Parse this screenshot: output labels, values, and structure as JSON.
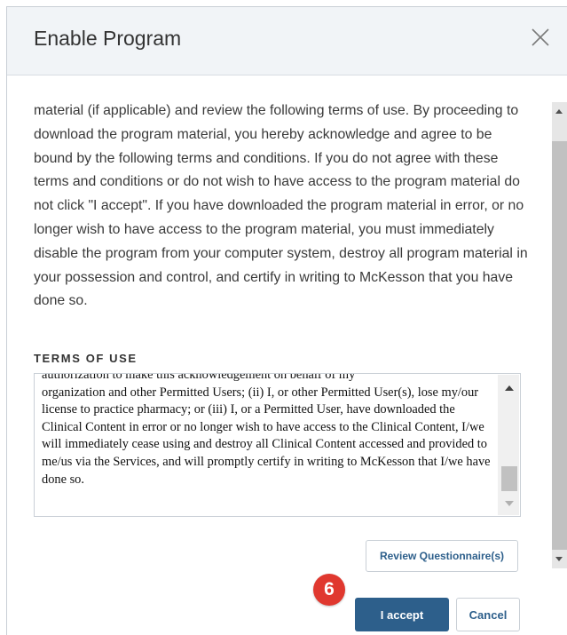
{
  "dialog": {
    "title": "Enable Program",
    "close_icon": "close-icon"
  },
  "intro_text": "material (if applicable) and review the following terms of use. By proceeding to download the program material, you hereby acknowledge and agree to be bound by the following terms and conditions. If you do not agree with these terms and conditions or do not wish to have access to the program material do not click \"I accept\". If you have downloaded the program material in error, or no longer wish to have access to the program material, you must immediately disable the program from your computer system, destroy all program material in your possession and control, and certify in writing to McKesson that you have done so.",
  "terms": {
    "heading": "TERMS OF USE",
    "partial_first_line": "authorization to make this acknowledgement on behalf of my",
    "text": "organization and other Permitted Users; (ii) I, or other Permitted User(s), lose my/our license to practice pharmacy; or (iii) I, or a Permitted User, have downloaded the Clinical Content in error or no longer wish to have access to the Clinical Content, I/we will immediately cease using and destroy all Clinical Content accessed and provided to me/us via the Services, and will promptly certify in writing to McKesson that I/we have done so."
  },
  "buttons": {
    "review": "Review Questionnaire(s)",
    "accept": "I accept",
    "cancel": "Cancel"
  },
  "annotation": {
    "step_number": "6"
  },
  "colors": {
    "primary": "#2d5f8b",
    "badge": "#e0382f",
    "header_bg": "#f1f4f7"
  }
}
